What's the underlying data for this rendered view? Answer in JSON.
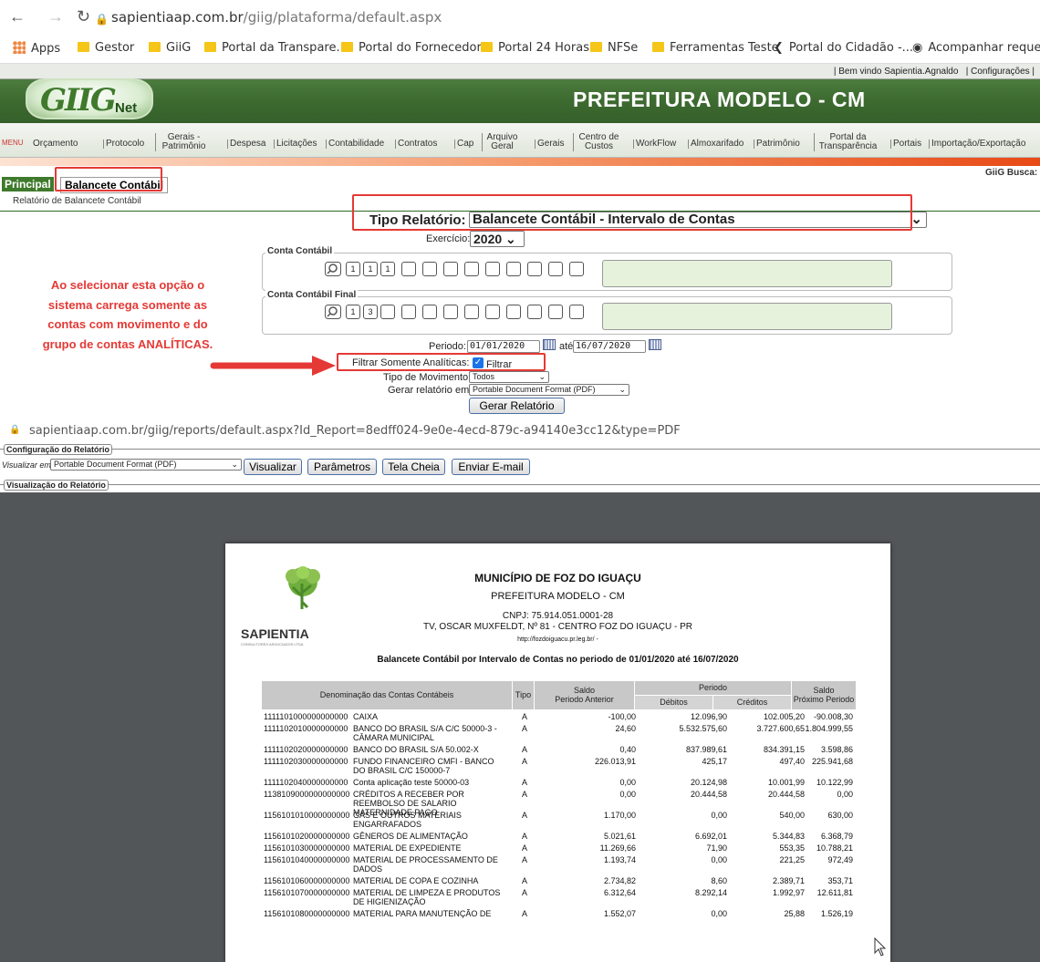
{
  "browser": {
    "url_host": "sapientiaap.com.br",
    "url_path": "/giig/plataforma/default.aspx",
    "bookmarks": [
      "Apps",
      "Gestor",
      "GiiG",
      "Portal da Transpare...",
      "Portal do Fornecedor",
      "Portal 24 Horas",
      "NFSe",
      "Ferramentas Teste",
      "Portal do Cidadão -...",
      "Acompanhar reque..."
    ]
  },
  "header": {
    "welcome": "| Bem vindo Sapientia.Agnaldo",
    "config": "| Configurações |",
    "logo_main": "GIIG",
    "logo_sub": "Net",
    "title": "PREFEITURA MODELO - CM"
  },
  "menu": {
    "label": "MENU",
    "items": [
      "Orçamento",
      "Protocolo",
      "Gerais - Patrimônio",
      "Despesa",
      "Licitações",
      "Contabilidade",
      "Contratos",
      "Cap",
      "Arquivo Geral",
      "Gerais",
      "Centro de Custos",
      "WorkFlow",
      "Almoxarifado",
      "Patrimônio",
      "Portal da Transparência",
      "Portais",
      "Importação/Exportação"
    ],
    "busca": "GiiG Busca:"
  },
  "tabs": {
    "principal": "Principal",
    "balancete": "Balancete Contábil"
  },
  "breadcrumb": "Relatório de Balancete Contábil",
  "form": {
    "tipo_label": "Tipo Relatório:",
    "tipo_value": "Balancete Contábil - Intervalo de Contas",
    "exercicio_label": "Exercício:",
    "exercicio_value": "2020",
    "conta_legend": "Conta Contábil",
    "conta_segments": [
      "1",
      "1",
      "1",
      "",
      "",
      "",
      "",
      "",
      "",
      "",
      "",
      ""
    ],
    "conta_final_legend": "Conta Contábil Final",
    "conta_final_segments": [
      "1",
      "3",
      "",
      "",
      "",
      "",
      "",
      "",
      "",
      "",
      "",
      ""
    ],
    "periodo_label": "Periodo:",
    "periodo_inicio": "01/01/2020",
    "ate": "até",
    "periodo_fim": "16/07/2020",
    "filtrar_label": "Filtrar Somente Analíticas:",
    "filtrar_text": "Filtrar",
    "tipo_mov_label": "Tipo de Movimento:",
    "tipo_mov_value": "Todos",
    "gerar_em_label": "Gerar relatório em:",
    "gerar_em_value": "Portable Document Format (PDF)",
    "gerar_btn": "Gerar Relatório"
  },
  "annotation": "Ao selecionar esta opção o sistema carrega somente as contas com movimento e do grupo de contas ANALÍTICAS.",
  "report_window": {
    "url": "sapientiaap.com.br/giig/reports/default.aspx?Id_Report=8edff024-9e0e-4ecd-879c-a94140e3cc12&type=PDF",
    "config_legend": "Configuração do Relatório",
    "visualizar_em_label": "Visualizar em:",
    "visualizar_em_value": "Portable Document Format (PDF)",
    "buttons": [
      "Visualizar",
      "Parâmetros",
      "Tela Cheia",
      "Enviar E-mail"
    ],
    "view_legend": "Visualização do Relatório"
  },
  "report": {
    "brand": "SAPIENTIA",
    "brand_sub": "CONSULTORES ASSOCIADOS LTDA",
    "municipio": "MUNICÍPIO DE FOZ DO IGUAÇU",
    "prefeitura": "PREFEITURA MODELO - CM",
    "cnpj": "CNPJ: 75.914.051.0001-28",
    "endereco": "TV, OSCAR MUXFELDT, Nº 81 - CENTRO FOZ DO IGUAÇU - PR",
    "site": "http://fozdoiguacu.pr.leg.br/ -",
    "titulo": "Balancete Contábil por Intervalo de Contas no periodo de 01/01/2020 até 16/07/2020",
    "headers": {
      "denominacao": "Denominação das Contas Contábeis",
      "tipo": "Tipo",
      "saldo_ant": "Saldo\nPeriodo Anterior",
      "periodo": "Periodo",
      "debitos": "Débitos",
      "creditos": "Créditos",
      "saldo_prox": "Saldo\nPróximo Periodo"
    },
    "rows": [
      {
        "conta": "1111101000000000000",
        "nome": "CAIXA",
        "tipo": "A",
        "ant": "-100,00",
        "deb": "12.096,90",
        "cred": "102.005,20",
        "prox": "-90.008,30"
      },
      {
        "conta": "1111102010000000000",
        "nome": "BANCO DO BRASIL S/A C/C 50000-3 - CÂMARA MUNICIPAL",
        "tipo": "A",
        "ant": "24,60",
        "deb": "5.532.575,60",
        "cred": "3.727.600,65",
        "prox": "1.804.999,55"
      },
      {
        "conta": "1111102020000000000",
        "nome": "BANCO DO BRASIL S/A 50.002-X",
        "tipo": "A",
        "ant": "0,40",
        "deb": "837.989,61",
        "cred": "834.391,15",
        "prox": "3.598,86"
      },
      {
        "conta": "1111102030000000000",
        "nome": "FUNDO FINANCEIRO CMFI - BANCO DO BRASIL C/C 150000-7",
        "tipo": "A",
        "ant": "226.013,91",
        "deb": "425,17",
        "cred": "497,40",
        "prox": "225.941,68"
      },
      {
        "conta": "1111102040000000000",
        "nome": "Conta aplicação teste 50000-03",
        "tipo": "A",
        "ant": "0,00",
        "deb": "20.124,98",
        "cred": "10.001,99",
        "prox": "10.122,99"
      },
      {
        "conta": "1138109000000000000",
        "nome": "CRÉDITOS A RECEBER POR REEMBOLSO DE SALARIO MATERNIDADE PAGO",
        "tipo": "A",
        "ant": "0,00",
        "deb": "20.444,58",
        "cred": "20.444,58",
        "prox": "0,00"
      },
      {
        "conta": "1156101010000000000",
        "nome": "GÁS E OUTROS MATERIAIS ENGARRAFADOS",
        "tipo": "A",
        "ant": "1.170,00",
        "deb": "0,00",
        "cred": "540,00",
        "prox": "630,00"
      },
      {
        "conta": "1156101020000000000",
        "nome": "GÊNEROS DE ALIMENTAÇÃO",
        "tipo": "A",
        "ant": "5.021,61",
        "deb": "6.692,01",
        "cred": "5.344,83",
        "prox": "6.368,79"
      },
      {
        "conta": "1156101030000000000",
        "nome": "MATERIAL DE EXPEDIENTE",
        "tipo": "A",
        "ant": "11.269,66",
        "deb": "71,90",
        "cred": "553,35",
        "prox": "10.788,21"
      },
      {
        "conta": "1156101040000000000",
        "nome": "MATERIAL DE PROCESSAMENTO DE DADOS",
        "tipo": "A",
        "ant": "1.193,74",
        "deb": "0,00",
        "cred": "221,25",
        "prox": "972,49"
      },
      {
        "conta": "1156101060000000000",
        "nome": "MATERIAL DE COPA E COZINHA",
        "tipo": "A",
        "ant": "2.734,82",
        "deb": "8,60",
        "cred": "2.389,71",
        "prox": "353,71"
      },
      {
        "conta": "1156101070000000000",
        "nome": "MATERIAL DE LIMPEZA E PRODUTOS DE HIGIENIZAÇÃO",
        "tipo": "A",
        "ant": "6.312,64",
        "deb": "8.292,14",
        "cred": "1.992,97",
        "prox": "12.611,81"
      },
      {
        "conta": "1156101080000000000",
        "nome": "MATERIAL PARA MANUTENÇÃO DE",
        "tipo": "A",
        "ant": "1.552,07",
        "deb": "0,00",
        "cred": "25,88",
        "prox": "1.526,19"
      }
    ]
  }
}
